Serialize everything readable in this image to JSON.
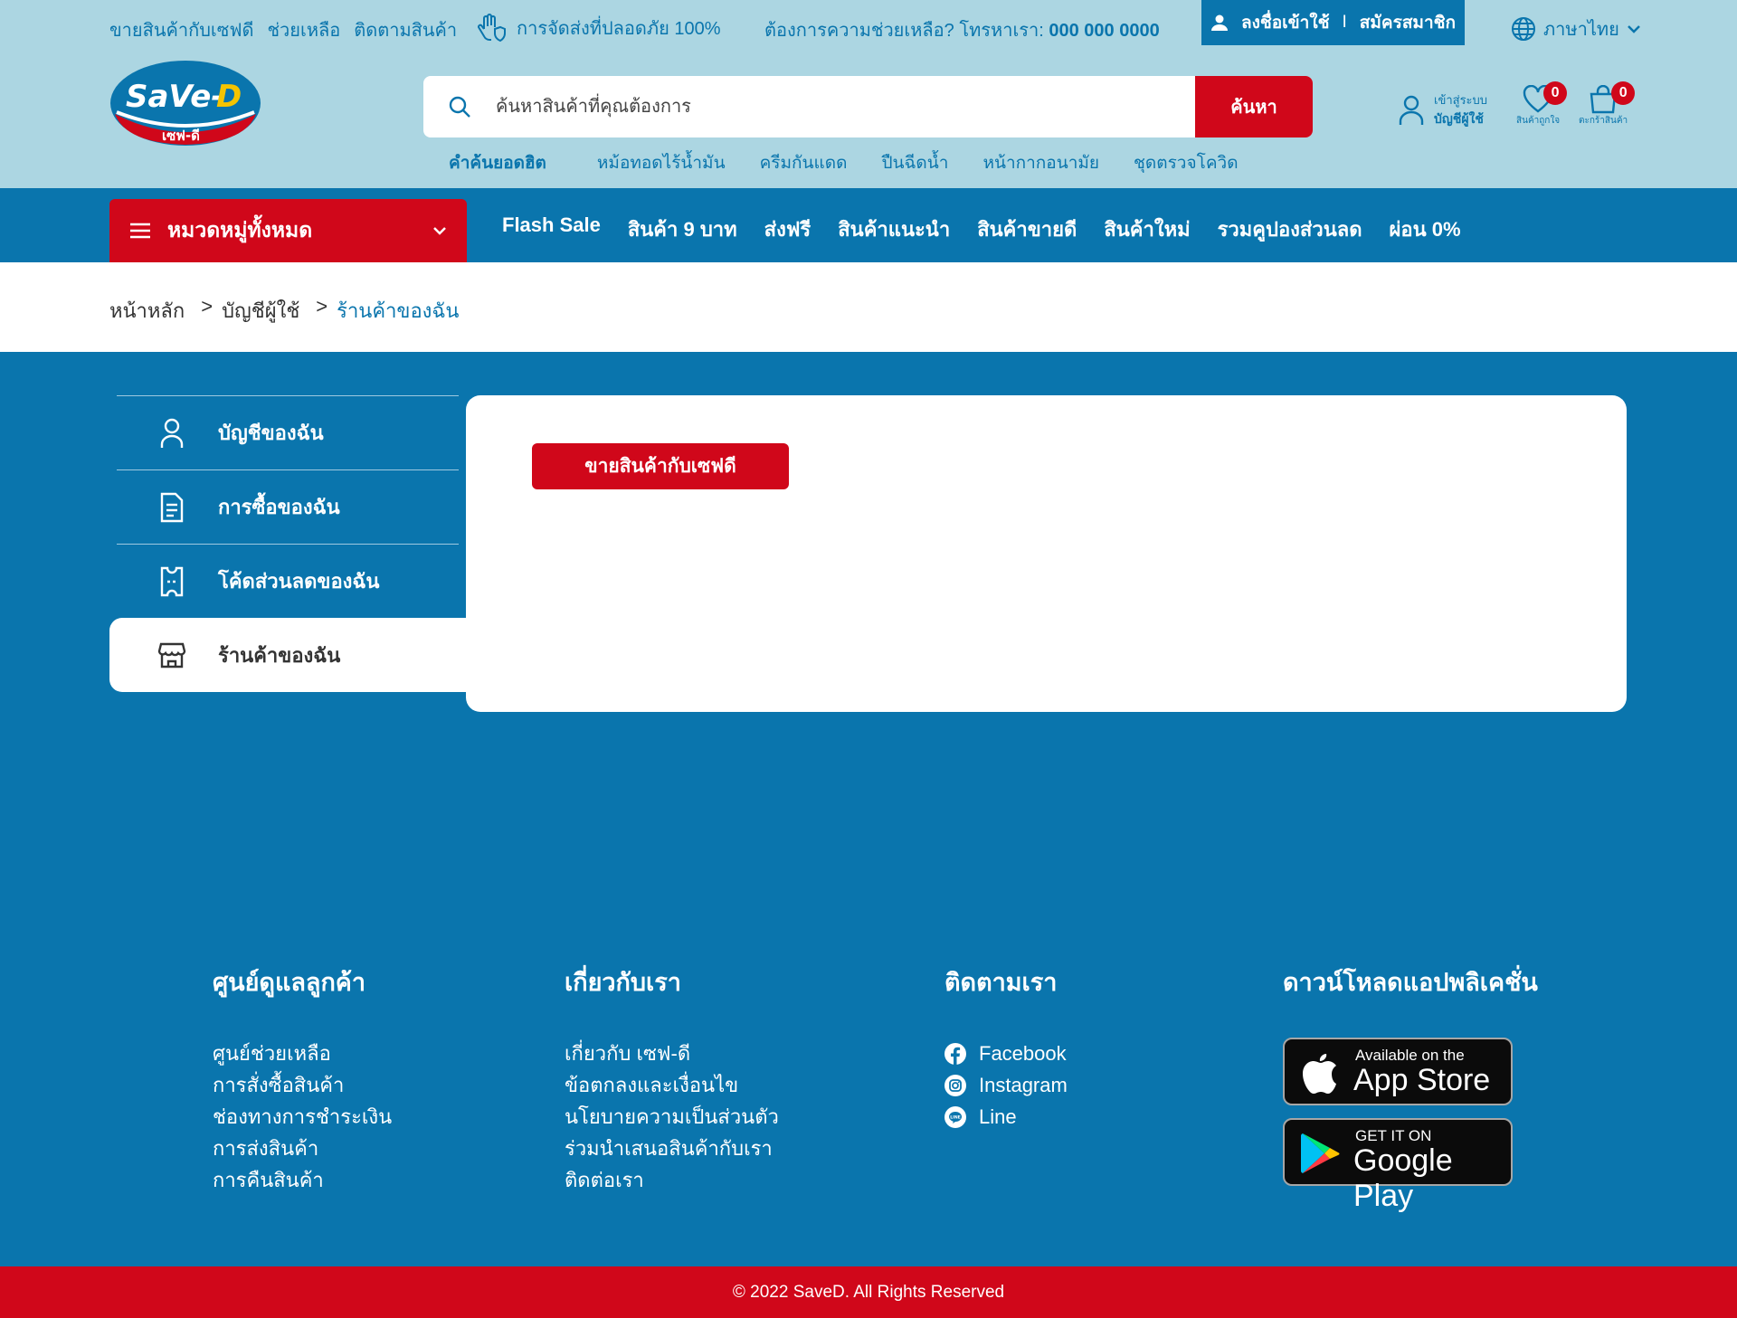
{
  "colors": {
    "primary": "#0a75ad",
    "accent": "#d0071a",
    "header_bg": "#acd6e2"
  },
  "topbar": {
    "links": [
      "ขายสินค้ากับเซฟดี",
      "ช่วยเหลือ",
      "ติดตามสินค้า"
    ],
    "safe_delivery": "การจัดส่งที่ปลอดภัย 100%",
    "help_text": "ต้องการความช่วยเหลือ? โทรหาเรา:",
    "help_phone": "000 000 0000",
    "login": "ลงชื่อเข้าใช้",
    "login_sep": "I",
    "register": "สมัครสมาชิก",
    "language": "ภาษาไทย"
  },
  "logo": {
    "text": "SaVe-D",
    "subtext": "เซฟ-ดี"
  },
  "search": {
    "placeholder": "ค้นหาสินค้าที่คุณต้องการ",
    "button": "ค้นหา",
    "hot_label": "คำค้นยอดฮิต",
    "hot_keywords": [
      "หม้อทอดไร้น้ำมัน",
      "ครีมกันแดด",
      "ปืนฉีดน้ำ",
      "หน้ากากอนามัย",
      "ชุดตรวจโควิด"
    ]
  },
  "account": {
    "line1": "เข้าสู่ระบบ",
    "line2": "บัญชีผู้ใช้"
  },
  "wishlist": {
    "label": "สินค้าถูกใจ",
    "count": "0"
  },
  "cart": {
    "label": "ตะกร้าสินค้า",
    "count": "0"
  },
  "nav": {
    "category_button": "หมวดหมู่ทั้งหมด",
    "links": [
      "Flash Sale",
      "สินค้า 9 บาท",
      "ส่งฟรี",
      "สินค้าแนะนำ",
      "สินค้าขายดี",
      "สินค้าใหม่",
      "รวมคูปองส่วนลด",
      "ผ่อน 0%"
    ]
  },
  "breadcrumb": {
    "home": "หน้าหลัก",
    "account": "บัญชีผู้ใช้",
    "current": "ร้านค้าของฉัน",
    "sep": ">"
  },
  "sidebar": {
    "items": [
      {
        "label": "บัญชีของฉัน",
        "icon": "user-icon"
      },
      {
        "label": "การซื้อของฉัน",
        "icon": "document-icon"
      },
      {
        "label": "โค้ดส่วนลดของฉัน",
        "icon": "coupon-icon"
      },
      {
        "label": "ร้านค้าของฉัน",
        "icon": "store-icon",
        "active": true
      }
    ]
  },
  "content": {
    "sell_button": "ขายสินค้ากับเซฟดี"
  },
  "footer": {
    "support": {
      "title": "ศูนย์ดูแลลูกค้า",
      "links": [
        "ศูนย์ช่วยเหลือ",
        "การสั่งซื้อสินค้า",
        "ช่องทางการชำระเงิน",
        "การส่งสินค้า",
        "การคืนสินค้า"
      ]
    },
    "about": {
      "title": "เกี่ยวกับเรา",
      "links": [
        "เกี่ยวกับ เซฟ-ดี",
        "ข้อตกลงและเงื่อนไข",
        "นโยบายความเป็นส่วนตัว",
        "ร่วมนำเสนอสินค้ากับเรา",
        "ติดต่อเรา"
      ]
    },
    "follow": {
      "title": "ติดตามเรา",
      "links": [
        "Facebook",
        "Instagram",
        "Line"
      ]
    },
    "download": {
      "title": "ดาวน์โหลดแอปพลิเคชั่น",
      "appstore_line1": "Available on the",
      "appstore_line2": "App Store",
      "googleplay_line1": "GET IT ON",
      "googleplay_line2": "Google Play"
    },
    "copyright": "© 2022 SaveD. All Rights Reserved"
  }
}
